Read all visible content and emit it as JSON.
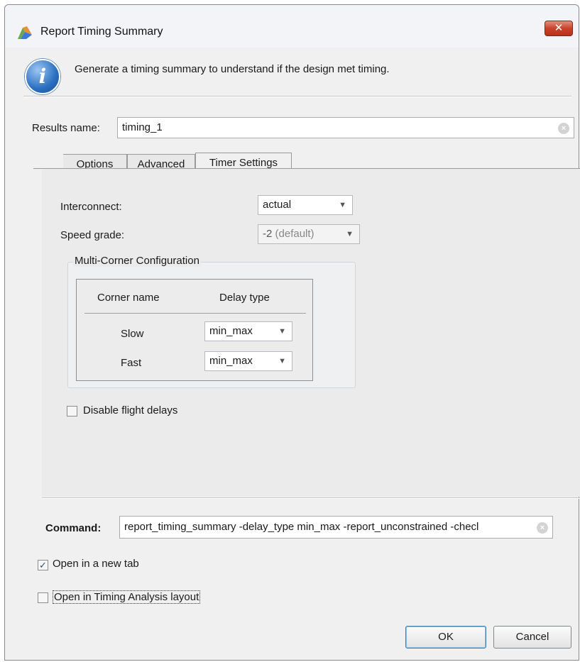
{
  "window": {
    "title": "Report Timing Summary",
    "close_label": "✕"
  },
  "info": {
    "icon_glyph": "i",
    "text": "Generate a timing summary to understand if the design met timing."
  },
  "results": {
    "label": "Results name:",
    "value": "timing_1"
  },
  "tabs": [
    {
      "label": "Options",
      "active": false
    },
    {
      "label": "Advanced",
      "active": false
    },
    {
      "label": "Timer Settings",
      "active": true
    }
  ],
  "timer_settings": {
    "interconnect_label": "Interconnect:",
    "interconnect_value": "actual",
    "speed_grade_label": "Speed grade:",
    "speed_grade_value": "-2",
    "speed_grade_suffix": "(default)",
    "multi_corner": {
      "title": "Multi-Corner Configuration",
      "columns": [
        "Corner name",
        "Delay type"
      ],
      "rows": [
        {
          "corner": "Slow",
          "delay": "min_max"
        },
        {
          "corner": "Fast",
          "delay": "min_max"
        }
      ]
    },
    "disable_flight_delays": {
      "label": "Disable flight delays",
      "checked": false
    }
  },
  "command": {
    "label": "Command:",
    "value": "report_timing_summary -delay_type min_max -report_unconstrained -checl"
  },
  "options": {
    "open_new_tab": {
      "label": "Open in a new tab",
      "checked": true
    },
    "open_timing_layout": {
      "label": "Open in Timing Analysis layout",
      "checked": false
    }
  },
  "buttons": {
    "ok": "OK",
    "cancel": "Cancel"
  },
  "colors": {
    "dialog_bg": "#f0f0f0",
    "close_button": "#c9432a",
    "info_icon": "#2a6fc0"
  }
}
